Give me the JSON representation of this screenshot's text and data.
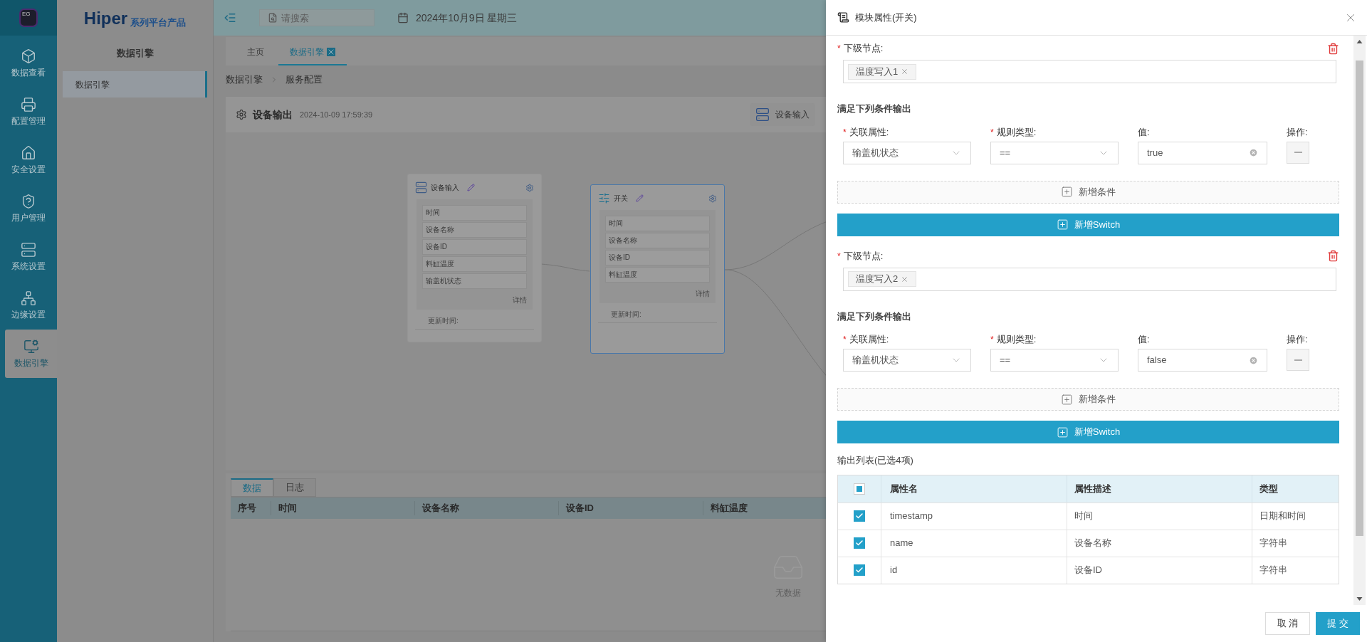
{
  "app_icon": {
    "text": "EG"
  },
  "nav_rail": {
    "items": [
      {
        "label": "数据查看",
        "selected": false
      },
      {
        "label": "配置管理",
        "selected": false
      },
      {
        "label": "安全设置",
        "selected": false
      },
      {
        "label": "用户管理",
        "selected": false
      },
      {
        "label": "系统设置",
        "selected": false
      },
      {
        "label": "边缘设置",
        "selected": false
      },
      {
        "label": "数据引擎",
        "selected": true
      }
    ]
  },
  "brand": {
    "name": "Hiper",
    "tagline": "系列平台产品"
  },
  "side_panel": {
    "title": "数据引擎",
    "items": [
      {
        "label": "数据引擎",
        "selected": true
      }
    ]
  },
  "top_bar": {
    "search": {
      "placeholder": "请搜索"
    },
    "date": "2024年10月9日 星期三"
  },
  "tabs": [
    {
      "label": "主页",
      "selected": false,
      "closable": false
    },
    {
      "label": "数据引擎",
      "selected": true,
      "closable": true
    }
  ],
  "breadcrumb": [
    "数据引擎",
    "服务配置"
  ],
  "flow_card": {
    "title": "设备输出",
    "timestamp": "2024-10-09 17:59:39",
    "toolbar_button": "设备输入",
    "nodes": [
      {
        "kind": "input",
        "title": "设备输入",
        "selected": false,
        "fields": [
          "时间",
          "设备名称",
          "设备ID",
          "料缸温度",
          "输盖机状态"
        ],
        "details": "详情",
        "update_label": "更新时间:"
      },
      {
        "kind": "switch",
        "title": "开关",
        "selected": true,
        "fields": [
          "时间",
          "设备名称",
          "设备ID",
          "料缸温度"
        ],
        "details": "详情",
        "update_label": "更新时间:"
      }
    ]
  },
  "bottom_panel": {
    "tabs": [
      {
        "label": "数据",
        "selected": true
      },
      {
        "label": "日志",
        "selected": false
      }
    ],
    "columns": [
      "序号",
      "时间",
      "设备名称",
      "设备ID",
      "料缸温度"
    ],
    "empty_text": "无数据"
  },
  "drawer": {
    "title": "模块属性(开关)",
    "switches": [
      {
        "next_node_required_mark": "*",
        "next_node_label": "下级节点:",
        "next_nodes": [
          "温度写入1"
        ],
        "conditions_title": "满足下列条件输出",
        "condition_columns": [
          {
            "label": "关联属性:",
            "required_mark": "*"
          },
          {
            "label": "规则类型:",
            "required_mark": "*"
          },
          {
            "label": "值:"
          },
          {
            "label": "操作:"
          }
        ],
        "conditions": [
          {
            "property": "输盖机状态",
            "rule": "==",
            "value": "true"
          }
        ],
        "add_condition": "新增条件",
        "add_switch": "新增Switch"
      },
      {
        "next_node_required_mark": "*",
        "next_node_label": "下级节点:",
        "next_nodes": [
          "温度写入2"
        ],
        "conditions_title": "满足下列条件输出",
        "condition_columns": [
          {
            "label": "关联属性:",
            "required_mark": "*"
          },
          {
            "label": "规则类型:",
            "required_mark": "*"
          },
          {
            "label": "值:"
          },
          {
            "label": "操作:"
          }
        ],
        "conditions": [
          {
            "property": "输盖机状态",
            "rule": "==",
            "value": "false"
          }
        ],
        "add_condition": "新增条件",
        "add_switch": "新增Switch"
      }
    ],
    "output_list": {
      "title": "输出列表(已选4项)",
      "select_all_indeterminate": true,
      "columns": [
        "属性名",
        "属性描述",
        "类型"
      ],
      "rows": [
        {
          "name": "timestamp",
          "description": "时间",
          "type": "日期和时间",
          "checked": true
        },
        {
          "name": "name",
          "description": "设备名称",
          "type": "字符串",
          "checked": true
        },
        {
          "name": "id",
          "description": "设备ID",
          "type": "字符串",
          "checked": true
        }
      ]
    },
    "buttons": [
      {
        "label": "取 消",
        "kind": "secondary"
      },
      {
        "label": "提 交",
        "kind": "primary"
      }
    ]
  }
}
